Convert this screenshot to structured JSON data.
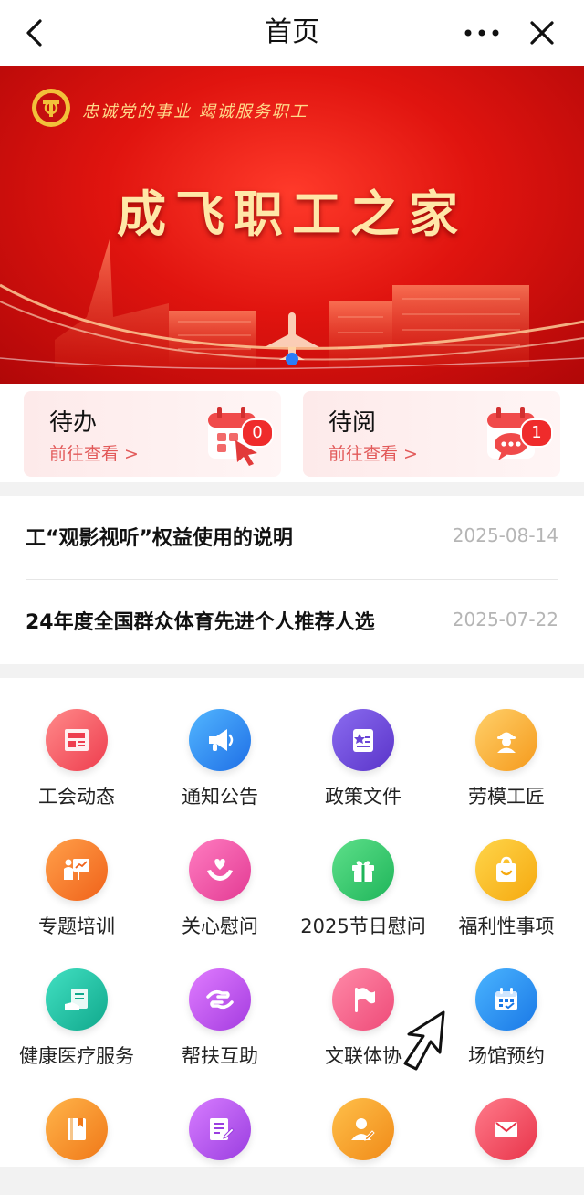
{
  "header": {
    "title": "首页"
  },
  "banner": {
    "slogan": "忠诚党的事业 竭诚服务职工",
    "title": "成飞职工之家"
  },
  "quick": [
    {
      "title": "待办",
      "link": "前往查看 >",
      "count": "0",
      "icon": "calendar-grid-icon"
    },
    {
      "title": "待阅",
      "link": "前往查看 >",
      "count": "1",
      "icon": "calendar-chat-icon"
    }
  ],
  "news": [
    {
      "title": "工“观影视听”权益使用的说明",
      "date": "2025-08-14"
    },
    {
      "title": "24年度全国群众体育先进个人推荐人选",
      "date": "2025-07-22"
    }
  ],
  "menu": [
    {
      "label": "工会动态",
      "icon": "newspaper-icon"
    },
    {
      "label": "通知公告",
      "icon": "megaphone-icon"
    },
    {
      "label": "政策文件",
      "icon": "policy-book-icon"
    },
    {
      "label": "劳模工匠",
      "icon": "worker-icon"
    },
    {
      "label": "专题培训",
      "icon": "training-board-icon"
    },
    {
      "label": "关心慰问",
      "icon": "heart-hands-icon"
    },
    {
      "label": "2025节日慰问",
      "icon": "gift-icon"
    },
    {
      "label": "福利性事项",
      "icon": "shopping-bag-icon"
    },
    {
      "label": "健康医疗服务",
      "icon": "medical-doc-icon"
    },
    {
      "label": "帮扶互助",
      "icon": "helping-hands-icon"
    },
    {
      "label": "文联体协",
      "icon": "flag-icon"
    },
    {
      "label": "场馆预约",
      "icon": "calendar-icon"
    },
    {
      "label": "",
      "icon": "book-icon"
    },
    {
      "label": "",
      "icon": "edit-doc-icon"
    },
    {
      "label": "",
      "icon": "user-pen-icon"
    },
    {
      "label": "",
      "icon": "mail-icon"
    }
  ],
  "colors": {
    "brand_red": "#e0140f",
    "link_red": "#e25a5a",
    "date_gray": "#b5b5b5"
  }
}
